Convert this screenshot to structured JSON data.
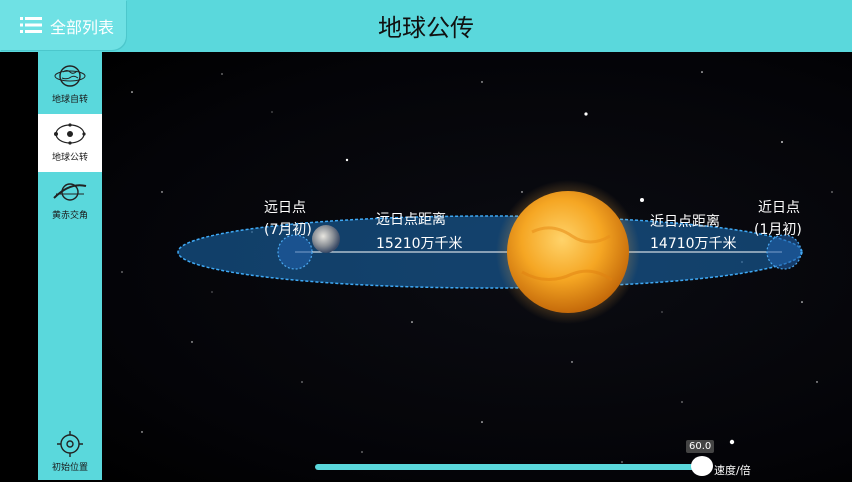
{
  "header": {
    "menu_label": "全部列表",
    "title": "地球公传"
  },
  "sidebar": {
    "items": [
      {
        "label": "地球自转",
        "icon": "earth-rotation-icon",
        "active": false
      },
      {
        "label": "地球公转",
        "icon": "orbit-icon",
        "active": true
      },
      {
        "label": "黄赤交角",
        "icon": "ecliptic-icon",
        "active": false
      }
    ],
    "reset_label": "初始位置"
  },
  "scene": {
    "aphelion_title": "远日点",
    "aphelion_date": "(7月初)",
    "perihelion_title": "近日点",
    "perihelion_date": "(1月初)",
    "aphelion_distance_label": "远日点距离",
    "aphelion_distance_value": "15210万千米",
    "perihelion_distance_label": "近日点距离",
    "perihelion_distance_value": "14710万千米"
  },
  "speed": {
    "value": "60.0",
    "label": "速度/倍",
    "fraction": 0.97
  },
  "colors": {
    "accent": "#5ad8dc",
    "orbit": "#2a8fd6",
    "sun": "#f5a623"
  }
}
